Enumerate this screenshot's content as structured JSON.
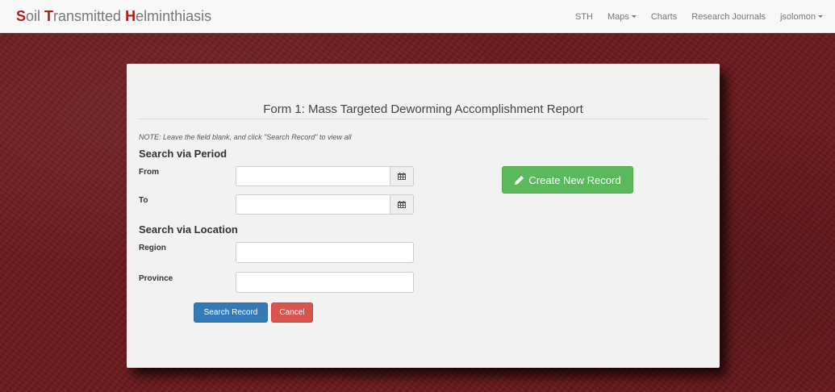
{
  "navbar": {
    "brand": [
      {
        "text": "S",
        "hl": true
      },
      {
        "text": "oil ",
        "hl": false
      },
      {
        "text": "T",
        "hl": true
      },
      {
        "text": "ransmitted ",
        "hl": false
      },
      {
        "text": "H",
        "hl": true
      },
      {
        "text": "elminthiasis",
        "hl": false
      }
    ],
    "links": {
      "sth": "STH",
      "maps": "Maps",
      "charts": "Charts",
      "research": "Research Journals",
      "user": "jsolomon"
    }
  },
  "form": {
    "title": "Form 1: Mass Targeted Deworming Accomplishment Report",
    "note": "NOTE: Leave the field blank, and click \"Search Record\" to view all",
    "period_heading": "Search via Period",
    "from_label": "From",
    "to_label": "To",
    "location_heading": "Search via Location",
    "region_label": "Region",
    "province_label": "Province",
    "from_value": "",
    "to_value": "",
    "region_value": "",
    "province_value": "",
    "search_button": "Search Record",
    "cancel_button": "Cancel",
    "create_button": "Create New Record"
  },
  "icons": {
    "calendar": "calendar-icon",
    "pencil": "pencil-icon",
    "caret": "caret-down-icon"
  },
  "colors": {
    "brand_accent": "#b01c1c",
    "primary": "#337ab7",
    "danger": "#d9534f",
    "success": "#5cb85c"
  }
}
